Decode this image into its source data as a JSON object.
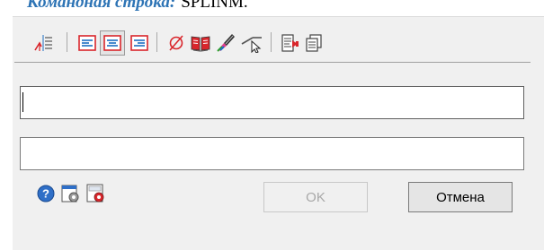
{
  "header": {
    "label_italic": "Командная строка:",
    "command": "SPLINM."
  },
  "toolbar": {
    "icons": [
      "text-height-icon",
      "align-left-icon",
      "align-center-icon",
      "align-right-icon",
      "diameter-icon",
      "book-icon",
      "paint-brush-icon",
      "leader-pointer-icon",
      "import-icon",
      "copy-icon"
    ],
    "active_icon": "align-center-icon"
  },
  "fields": {
    "upper_value": "",
    "lower_value": ""
  },
  "bottom": {
    "icons": [
      "help-icon",
      "settings-icon",
      "gost-settings-icon"
    ],
    "ok_label": "OK",
    "cancel_label": "Отмена"
  },
  "colors": {
    "dialog_bg": "#f0f0f0",
    "accent_blue": "#1b6ec2",
    "red": "#d9262c"
  }
}
